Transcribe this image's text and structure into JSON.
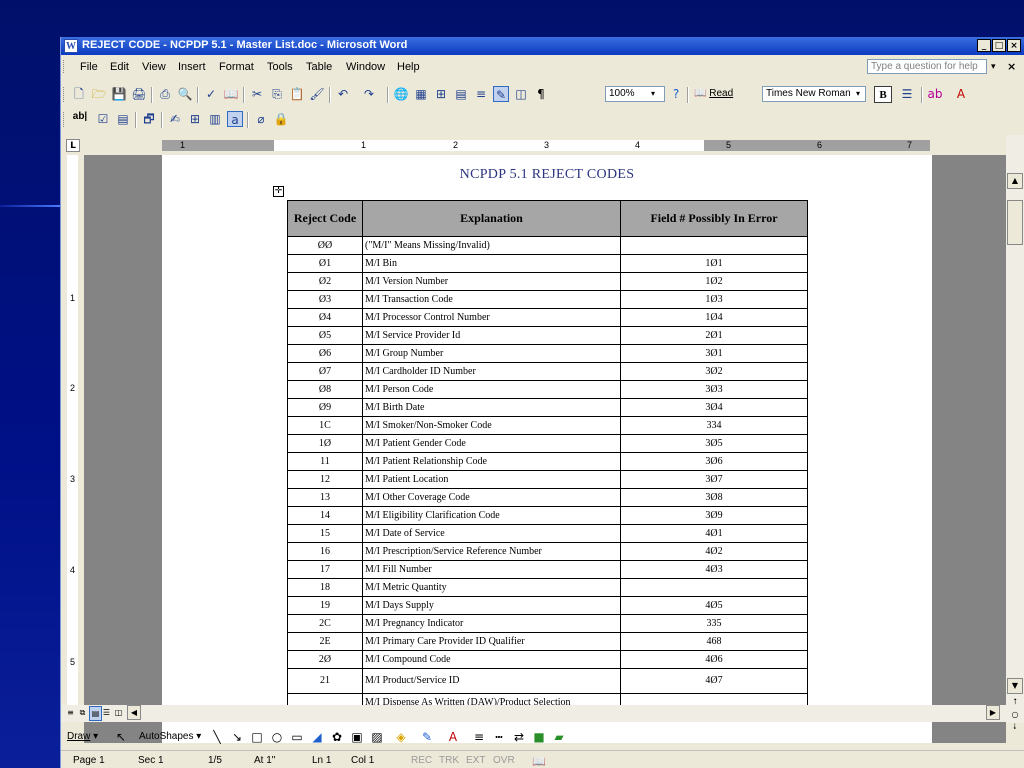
{
  "window": {
    "title": "REJECT CODE - NCPDP 5.1 - Master List.doc - Microsoft Word",
    "min_label": "_",
    "max_label": "□",
    "close_label": "×"
  },
  "menu": {
    "items": [
      "File",
      "Edit",
      "View",
      "Insert",
      "Format",
      "Tools",
      "Table",
      "Window",
      "Help"
    ],
    "help_placeholder": "Type a question for help",
    "close_glyph": "×"
  },
  "toolbar": {
    "zoom": "100%",
    "read_label": "Read",
    "font_name": "Times New Roman",
    "bold_label": "B",
    "ab_label": "ab|"
  },
  "ruler": {
    "numbers": [
      "1",
      "1",
      "2",
      "3",
      "4",
      "5",
      "6",
      "7"
    ]
  },
  "left_ruler": {
    "numbers": [
      "1",
      "2",
      "3",
      "4",
      "5"
    ]
  },
  "document": {
    "title": "NCPDP 5.1 REJECT CODES",
    "table": {
      "headers": [
        "Reject Code",
        "Explanation",
        "Field # Possibly In Error"
      ],
      "rows": [
        [
          "ØØ",
          "(\"M/I\" Means Missing/Invalid)",
          ""
        ],
        [
          "Ø1",
          "M/I Bin",
          "1Ø1"
        ],
        [
          "Ø2",
          "M/I Version Number",
          "1Ø2"
        ],
        [
          "Ø3",
          "M/I Transaction Code",
          "1Ø3"
        ],
        [
          "Ø4",
          "M/I Processor Control Number",
          "1Ø4"
        ],
        [
          "Ø5",
          "M/I Service Provider Id",
          "2Ø1"
        ],
        [
          "Ø6",
          "M/I Group Number",
          "3Ø1"
        ],
        [
          "Ø7",
          "M/I Cardholder ID Number",
          "3Ø2"
        ],
        [
          "Ø8",
          "M/I Person Code",
          "3Ø3"
        ],
        [
          "Ø9",
          "M/I Birth Date",
          "3Ø4"
        ],
        [
          "1C",
          "M/I Smoker/Non-Smoker Code",
          "334"
        ],
        [
          "1Ø",
          "M/I Patient Gender Code",
          "3Ø5"
        ],
        [
          "11",
          "M/I Patient Relationship Code",
          "3Ø6"
        ],
        [
          "12",
          "M/I Patient Location",
          "3Ø7"
        ],
        [
          "13",
          "M/I Other Coverage Code",
          "3Ø8"
        ],
        [
          "14",
          "M/I Eligibility Clarification Code",
          "3Ø9"
        ],
        [
          "15",
          "M/I Date of Service",
          "4Ø1"
        ],
        [
          "16",
          "M/I Prescription/Service Reference Number",
          "4Ø2"
        ],
        [
          "17",
          "M/I Fill Number",
          "4Ø3"
        ],
        [
          "18",
          "M/I Metric Quantity",
          ""
        ],
        [
          "19",
          "M/I Days Supply",
          "4Ø5"
        ],
        [
          "2C",
          "M/I Pregnancy Indicator",
          "335"
        ],
        [
          "2E",
          "M/I Primary Care Provider ID Qualifier",
          "468"
        ],
        [
          "2Ø",
          "M/I Compound Code",
          "4Ø6"
        ],
        [
          "21",
          "M/I Product/Service ID",
          "4Ø7"
        ],
        [
          "",
          "M/I Dispense As Written (DAW)/Product Selection",
          ""
        ]
      ]
    }
  },
  "drawbar": {
    "draw_label": "Draw",
    "autoshapes_label": "AutoShapes"
  },
  "status": {
    "page": "Page 1",
    "sec": "Sec 1",
    "pages": "1/5",
    "at": "At 1\"",
    "ln": "Ln 1",
    "col": "Col 1",
    "rec": "REC",
    "trk": "TRK",
    "ext": "EXT",
    "ovr": "OVR"
  },
  "colors": {
    "titlebar": "#0a3ac0",
    "slide_bg": "#001087",
    "doc_title": "#2b3480"
  }
}
